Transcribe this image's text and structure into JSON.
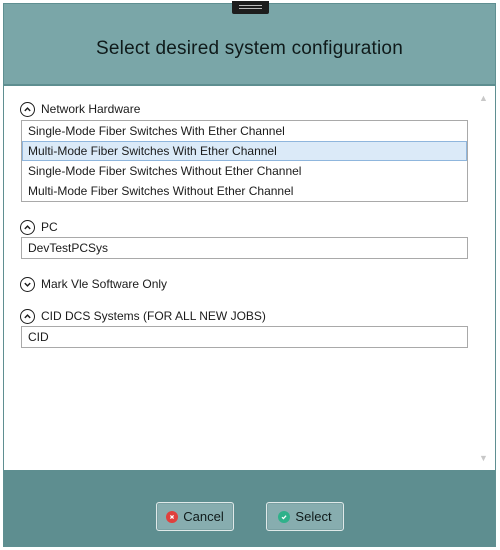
{
  "dialog": {
    "title": "Select desired system configuration"
  },
  "sections": [
    {
      "label": "Network Hardware",
      "expanded": true,
      "options": [
        "Single-Mode Fiber Switches With Ether Channel",
        "Multi-Mode Fiber Switches With Ether Channel",
        "Single-Mode Fiber Switches Without Ether Channel",
        "Multi-Mode Fiber Switches Without Ether Channel"
      ],
      "selected_index": 1
    },
    {
      "label": "PC",
      "expanded": true,
      "value": "DevTestPCSys"
    },
    {
      "label": "Mark Vle Software Only",
      "expanded": false
    },
    {
      "label": "CID DCS Systems (FOR ALL NEW JOBS)",
      "expanded": true,
      "value": "CID"
    }
  ],
  "buttons": {
    "cancel_label": "Cancel",
    "select_label": "Select"
  },
  "colors": {
    "header": "#7aa6a8",
    "footer": "#5e8e90",
    "button": "#87adaf",
    "selection": "#dbeaf8",
    "cancel_icon": "#e0403d",
    "select_icon": "#2fb18a"
  },
  "icons": {
    "collapse": "chevron-up-circle-icon",
    "expand": "chevron-down-circle-icon",
    "cancel": "close-circle-icon",
    "select": "check-circle-icon"
  }
}
